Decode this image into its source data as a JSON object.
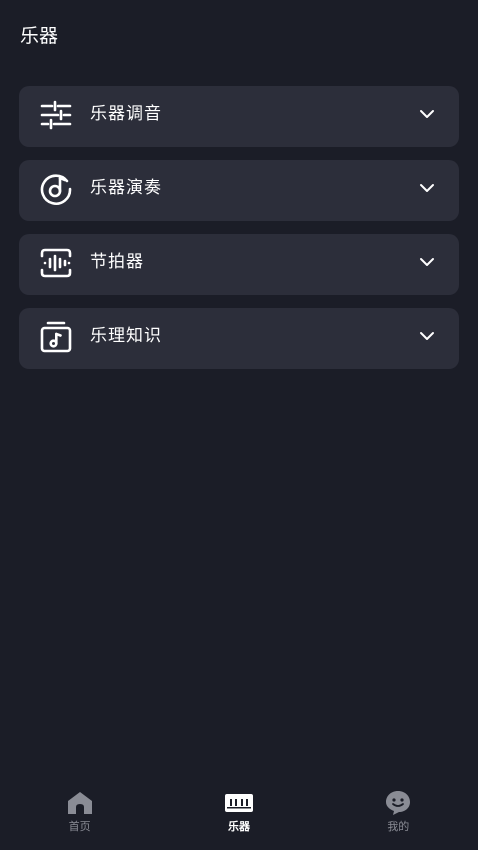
{
  "header": {
    "title": "乐器"
  },
  "menu": {
    "items": [
      {
        "label": "乐器调音",
        "icon": "sliders-icon"
      },
      {
        "label": "乐器演奏",
        "icon": "music-disc-icon"
      },
      {
        "label": "节拍器",
        "icon": "metronome-wave-icon"
      },
      {
        "label": "乐理知识",
        "icon": "music-note-box-icon"
      }
    ]
  },
  "tabbar": {
    "active_index": 1,
    "tabs": [
      {
        "label": "首页",
        "icon": "home-icon"
      },
      {
        "label": "乐器",
        "icon": "piano-icon"
      },
      {
        "label": "我的",
        "icon": "chat-face-icon"
      }
    ]
  },
  "colors": {
    "background": "#1b1d27",
    "card": "#2c2e3a",
    "text": "#ffffff",
    "inactive": "#8a8c95"
  }
}
